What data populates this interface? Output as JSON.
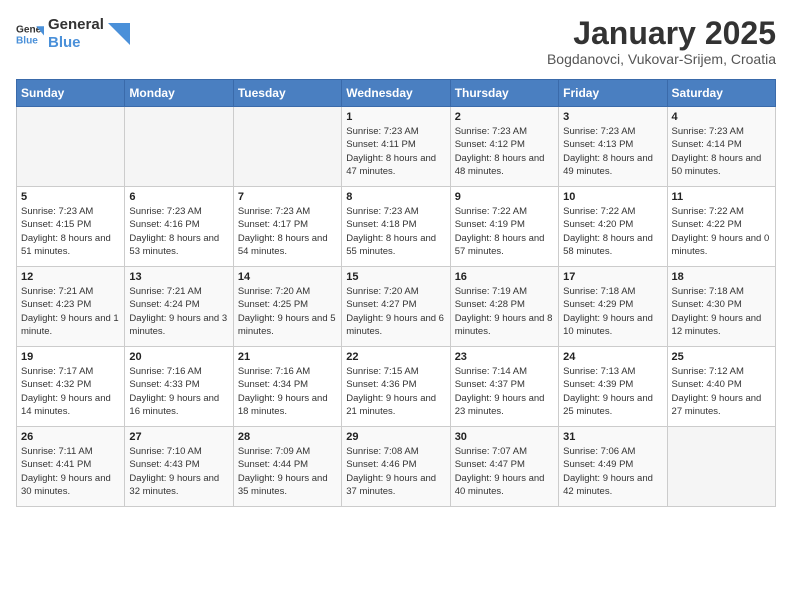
{
  "header": {
    "logo_line1": "General",
    "logo_line2": "Blue",
    "title": "January 2025",
    "subtitle": "Bogdanovci, Vukovar-Srijem, Croatia"
  },
  "weekdays": [
    "Sunday",
    "Monday",
    "Tuesday",
    "Wednesday",
    "Thursday",
    "Friday",
    "Saturday"
  ],
  "weeks": [
    [
      {
        "day": "",
        "info": ""
      },
      {
        "day": "",
        "info": ""
      },
      {
        "day": "",
        "info": ""
      },
      {
        "day": "1",
        "info": "Sunrise: 7:23 AM\nSunset: 4:11 PM\nDaylight: 8 hours and 47 minutes."
      },
      {
        "day": "2",
        "info": "Sunrise: 7:23 AM\nSunset: 4:12 PM\nDaylight: 8 hours and 48 minutes."
      },
      {
        "day": "3",
        "info": "Sunrise: 7:23 AM\nSunset: 4:13 PM\nDaylight: 8 hours and 49 minutes."
      },
      {
        "day": "4",
        "info": "Sunrise: 7:23 AM\nSunset: 4:14 PM\nDaylight: 8 hours and 50 minutes."
      }
    ],
    [
      {
        "day": "5",
        "info": "Sunrise: 7:23 AM\nSunset: 4:15 PM\nDaylight: 8 hours and 51 minutes."
      },
      {
        "day": "6",
        "info": "Sunrise: 7:23 AM\nSunset: 4:16 PM\nDaylight: 8 hours and 53 minutes."
      },
      {
        "day": "7",
        "info": "Sunrise: 7:23 AM\nSunset: 4:17 PM\nDaylight: 8 hours and 54 minutes."
      },
      {
        "day": "8",
        "info": "Sunrise: 7:23 AM\nSunset: 4:18 PM\nDaylight: 8 hours and 55 minutes."
      },
      {
        "day": "9",
        "info": "Sunrise: 7:22 AM\nSunset: 4:19 PM\nDaylight: 8 hours and 57 minutes."
      },
      {
        "day": "10",
        "info": "Sunrise: 7:22 AM\nSunset: 4:20 PM\nDaylight: 8 hours and 58 minutes."
      },
      {
        "day": "11",
        "info": "Sunrise: 7:22 AM\nSunset: 4:22 PM\nDaylight: 9 hours and 0 minutes."
      }
    ],
    [
      {
        "day": "12",
        "info": "Sunrise: 7:21 AM\nSunset: 4:23 PM\nDaylight: 9 hours and 1 minute."
      },
      {
        "day": "13",
        "info": "Sunrise: 7:21 AM\nSunset: 4:24 PM\nDaylight: 9 hours and 3 minutes."
      },
      {
        "day": "14",
        "info": "Sunrise: 7:20 AM\nSunset: 4:25 PM\nDaylight: 9 hours and 5 minutes."
      },
      {
        "day": "15",
        "info": "Sunrise: 7:20 AM\nSunset: 4:27 PM\nDaylight: 9 hours and 6 minutes."
      },
      {
        "day": "16",
        "info": "Sunrise: 7:19 AM\nSunset: 4:28 PM\nDaylight: 9 hours and 8 minutes."
      },
      {
        "day": "17",
        "info": "Sunrise: 7:18 AM\nSunset: 4:29 PM\nDaylight: 9 hours and 10 minutes."
      },
      {
        "day": "18",
        "info": "Sunrise: 7:18 AM\nSunset: 4:30 PM\nDaylight: 9 hours and 12 minutes."
      }
    ],
    [
      {
        "day": "19",
        "info": "Sunrise: 7:17 AM\nSunset: 4:32 PM\nDaylight: 9 hours and 14 minutes."
      },
      {
        "day": "20",
        "info": "Sunrise: 7:16 AM\nSunset: 4:33 PM\nDaylight: 9 hours and 16 minutes."
      },
      {
        "day": "21",
        "info": "Sunrise: 7:16 AM\nSunset: 4:34 PM\nDaylight: 9 hours and 18 minutes."
      },
      {
        "day": "22",
        "info": "Sunrise: 7:15 AM\nSunset: 4:36 PM\nDaylight: 9 hours and 21 minutes."
      },
      {
        "day": "23",
        "info": "Sunrise: 7:14 AM\nSunset: 4:37 PM\nDaylight: 9 hours and 23 minutes."
      },
      {
        "day": "24",
        "info": "Sunrise: 7:13 AM\nSunset: 4:39 PM\nDaylight: 9 hours and 25 minutes."
      },
      {
        "day": "25",
        "info": "Sunrise: 7:12 AM\nSunset: 4:40 PM\nDaylight: 9 hours and 27 minutes."
      }
    ],
    [
      {
        "day": "26",
        "info": "Sunrise: 7:11 AM\nSunset: 4:41 PM\nDaylight: 9 hours and 30 minutes."
      },
      {
        "day": "27",
        "info": "Sunrise: 7:10 AM\nSunset: 4:43 PM\nDaylight: 9 hours and 32 minutes."
      },
      {
        "day": "28",
        "info": "Sunrise: 7:09 AM\nSunset: 4:44 PM\nDaylight: 9 hours and 35 minutes."
      },
      {
        "day": "29",
        "info": "Sunrise: 7:08 AM\nSunset: 4:46 PM\nDaylight: 9 hours and 37 minutes."
      },
      {
        "day": "30",
        "info": "Sunrise: 7:07 AM\nSunset: 4:47 PM\nDaylight: 9 hours and 40 minutes."
      },
      {
        "day": "31",
        "info": "Sunrise: 7:06 AM\nSunset: 4:49 PM\nDaylight: 9 hours and 42 minutes."
      },
      {
        "day": "",
        "info": ""
      }
    ]
  ]
}
